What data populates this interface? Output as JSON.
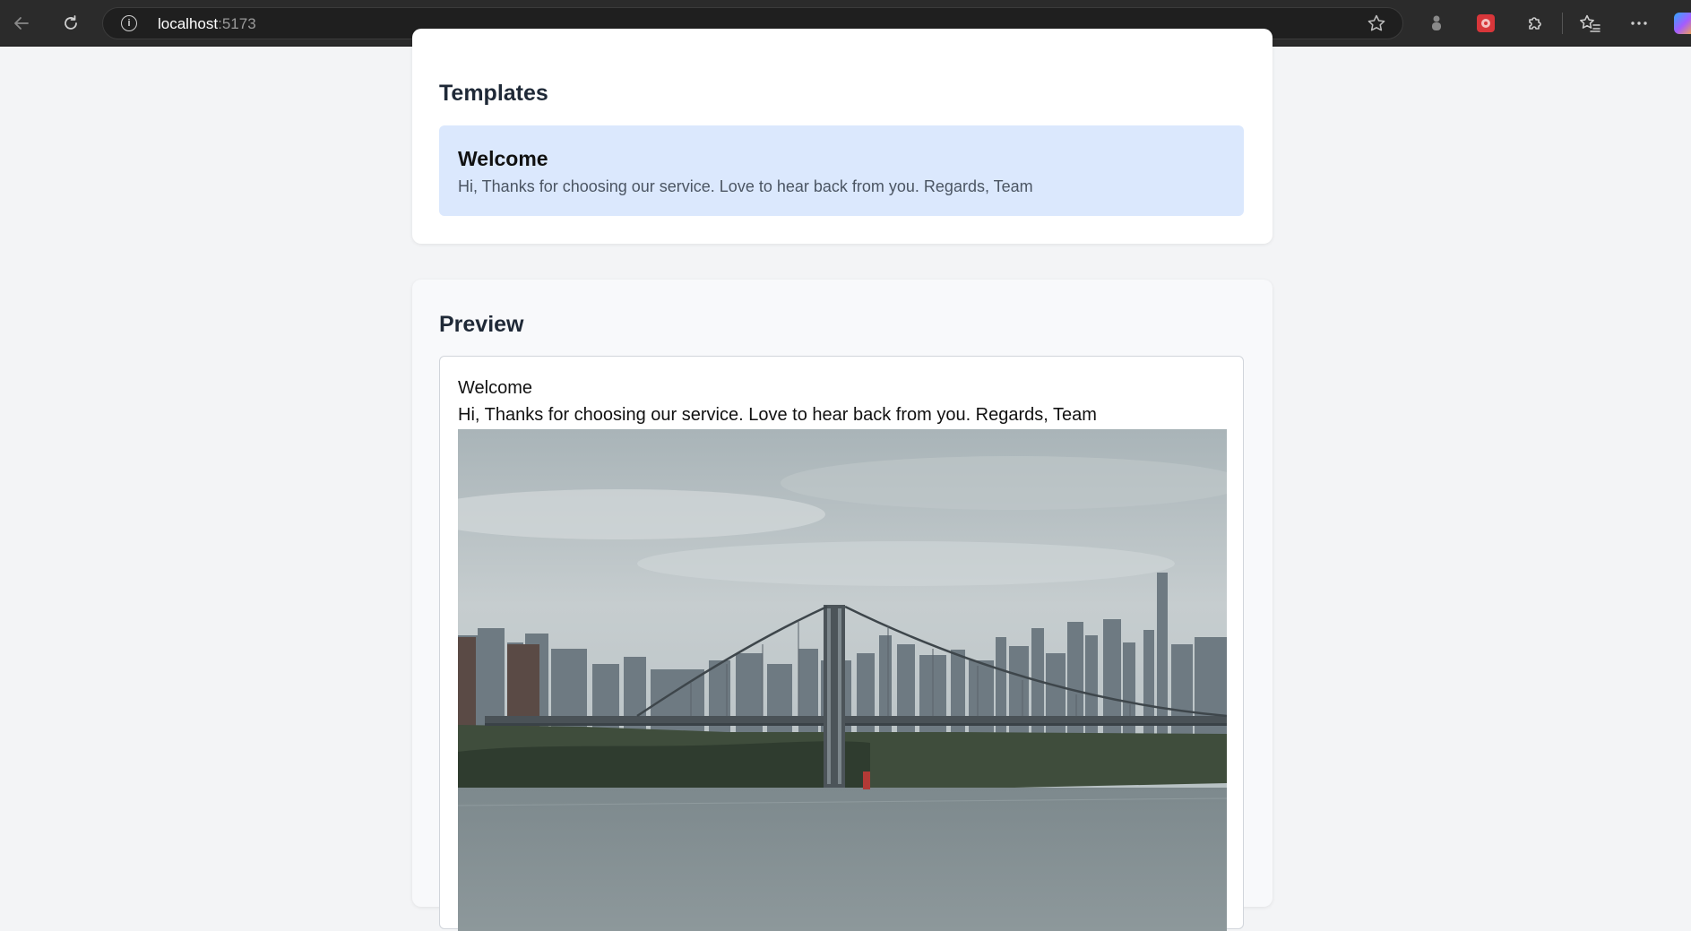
{
  "browser": {
    "url_host": "localhost",
    "url_port": ":5173"
  },
  "templates": {
    "heading": "Templates",
    "items": [
      {
        "name": "Welcome",
        "body": "Hi, Thanks for choosing our service. Love to hear back from you. Regards, Team"
      }
    ]
  },
  "preview": {
    "heading": "Preview",
    "title": "Welcome",
    "body": "Hi, Thanks for choosing our service. Love to hear back from you. Regards, Team",
    "image_subject": "bridge-city-skyline-photo"
  },
  "colors": {
    "template_selected_bg": "#dbe8fd",
    "page_bg": "#f3f4f6"
  }
}
